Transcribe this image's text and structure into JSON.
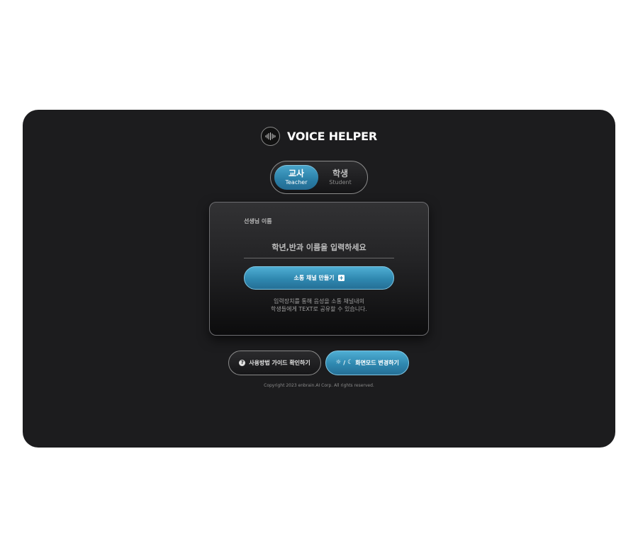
{
  "brand": {
    "title": "VOICE HELPER",
    "logo_icon": "soundwave-icon"
  },
  "role_toggle": {
    "tabs": [
      {
        "label_ko": "교사",
        "label_en": "Teacher",
        "active": true
      },
      {
        "label_ko": "학생",
        "label_en": "Student",
        "active": false
      }
    ]
  },
  "form": {
    "label": "선생님 이름",
    "name_placeholder": "학년,반과 이름을 입력하세요",
    "name_value": "",
    "create_button_label": "소통 채널 만들기",
    "create_button_icon": "plus-square-icon",
    "description_line1": "입력장치를 통해 음성을 소통 채널내의",
    "description_line2": "학생들에게 TEXT로 공유할 수 있습니다."
  },
  "footer": {
    "guide_button_label": "사용방법 가이드 확인하기",
    "guide_icon": "question-circle-icon",
    "mode_separator": "/",
    "mode_button_label": "화면모드 변경하기",
    "mode_icons": [
      "sun-icon",
      "moon-icon"
    ],
    "copyright": "Copyright 2023 enbrain.AI Corp. All rights reserved."
  },
  "colors": {
    "panel_bg": "#1c1c1e",
    "accent": "#2f88b0",
    "accent_light": "#4faed3"
  }
}
